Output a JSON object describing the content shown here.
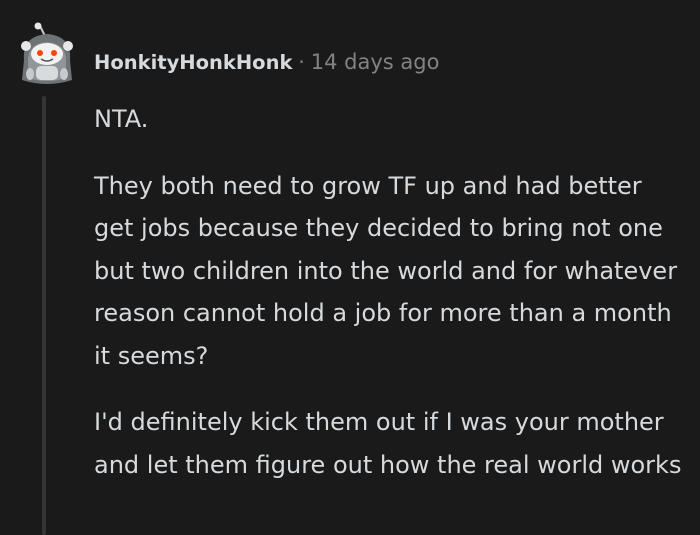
{
  "comment": {
    "username": "HonkityHonkHonk",
    "separator": "·",
    "timestamp": "14 days ago",
    "paragraphs": [
      "NTA.",
      "They both need to grow TF up and had better get jobs because they decided to bring not one but two children into the world and for whatever reason cannot hold a job for more than a month it seems?",
      "I'd definitely kick them out if I was your mother and let them figure out how the real world works"
    ]
  },
  "colors": {
    "background": "#1a1a1b",
    "text": "#d7dadc",
    "meta": "#818384",
    "thread_line": "#343536",
    "avatar_accent": "#ff4500"
  },
  "icons": {
    "avatar": "snoo-avatar-icon"
  }
}
